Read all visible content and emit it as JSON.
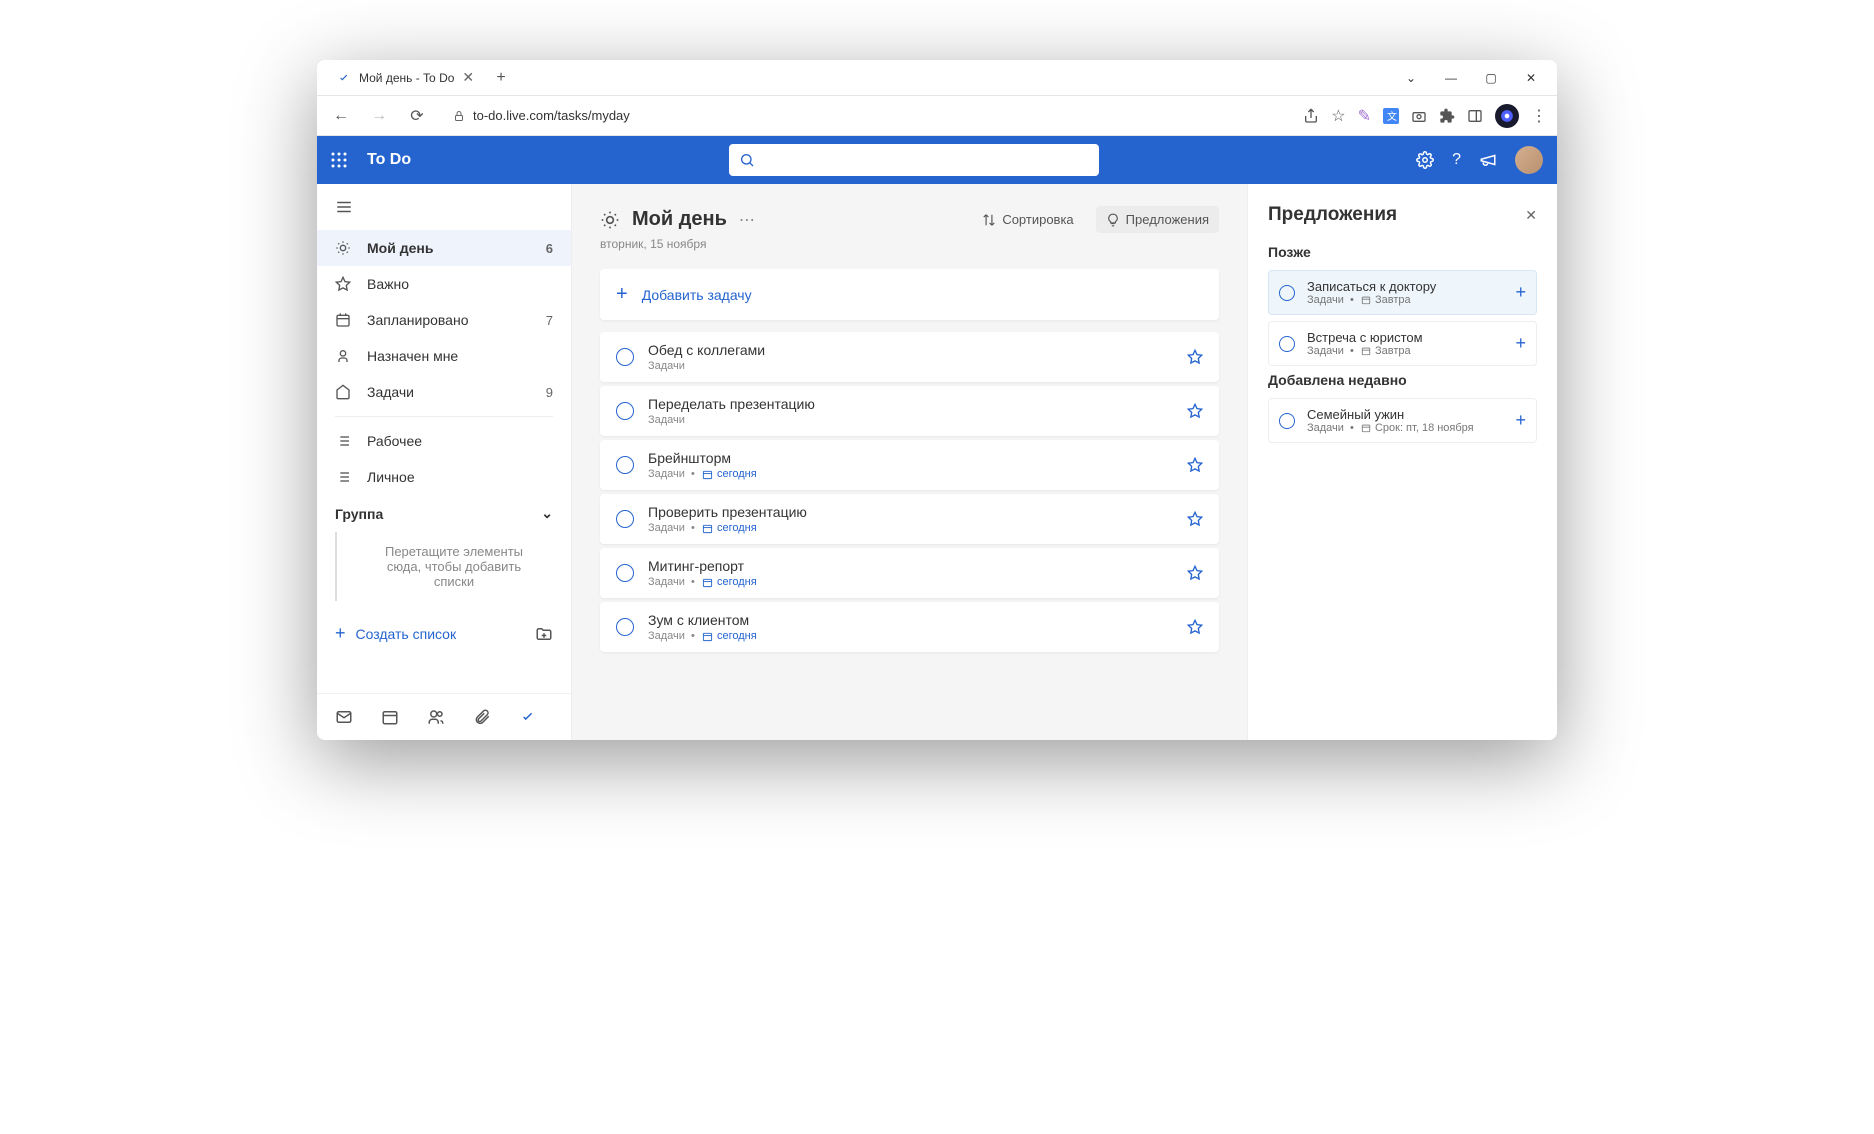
{
  "browser": {
    "tab_title": "Мой день - To Do",
    "url": "to-do.live.com/tasks/myday"
  },
  "header": {
    "app_name": "To Do"
  },
  "sidebar": {
    "items": [
      {
        "label": "Мой день",
        "count": "6",
        "icon": "sun"
      },
      {
        "label": "Важно",
        "count": "",
        "icon": "star"
      },
      {
        "label": "Запланировано",
        "count": "7",
        "icon": "calendar"
      },
      {
        "label": "Назначен мне",
        "count": "",
        "icon": "person"
      },
      {
        "label": "Задачи",
        "count": "9",
        "icon": "home"
      }
    ],
    "custom_lists": [
      {
        "label": "Рабочее"
      },
      {
        "label": "Личное"
      }
    ],
    "group_label": "Группа",
    "group_hint": "Перетащите элементы сюда, чтобы добавить списки",
    "create_list": "Создать список"
  },
  "main": {
    "title": "Мой день",
    "date": "вторник, 15 ноября",
    "sort_label": "Сортировка",
    "suggestions_label": "Предложения",
    "add_task_label": "Добавить задачу",
    "tasks": [
      {
        "title": "Обед с коллегами",
        "list": "Задачи",
        "due": ""
      },
      {
        "title": "Переделать презентацию",
        "list": "Задачи",
        "due": ""
      },
      {
        "title": "Брейншторм",
        "list": "Задачи",
        "due": "сегодня"
      },
      {
        "title": "Проверить презентацию",
        "list": "Задачи",
        "due": "сегодня"
      },
      {
        "title": "Митинг-репорт",
        "list": "Задачи",
        "due": "сегодня"
      },
      {
        "title": "Зум с клиентом",
        "list": "Задачи",
        "due": "сегодня"
      }
    ]
  },
  "panel": {
    "title": "Предложения",
    "sections": [
      {
        "label": "Позже",
        "items": [
          {
            "title": "Записаться к доктору",
            "list": "Задачи",
            "due": "Завтра",
            "highlight": true
          },
          {
            "title": "Встреча с юристом",
            "list": "Задачи",
            "due": "Завтра",
            "highlight": false
          }
        ]
      },
      {
        "label": "Добавлена недавно",
        "items": [
          {
            "title": "Семейный ужин",
            "list": "Задачи",
            "due": "Срок: пт, 18 ноября",
            "highlight": false
          }
        ]
      }
    ]
  }
}
